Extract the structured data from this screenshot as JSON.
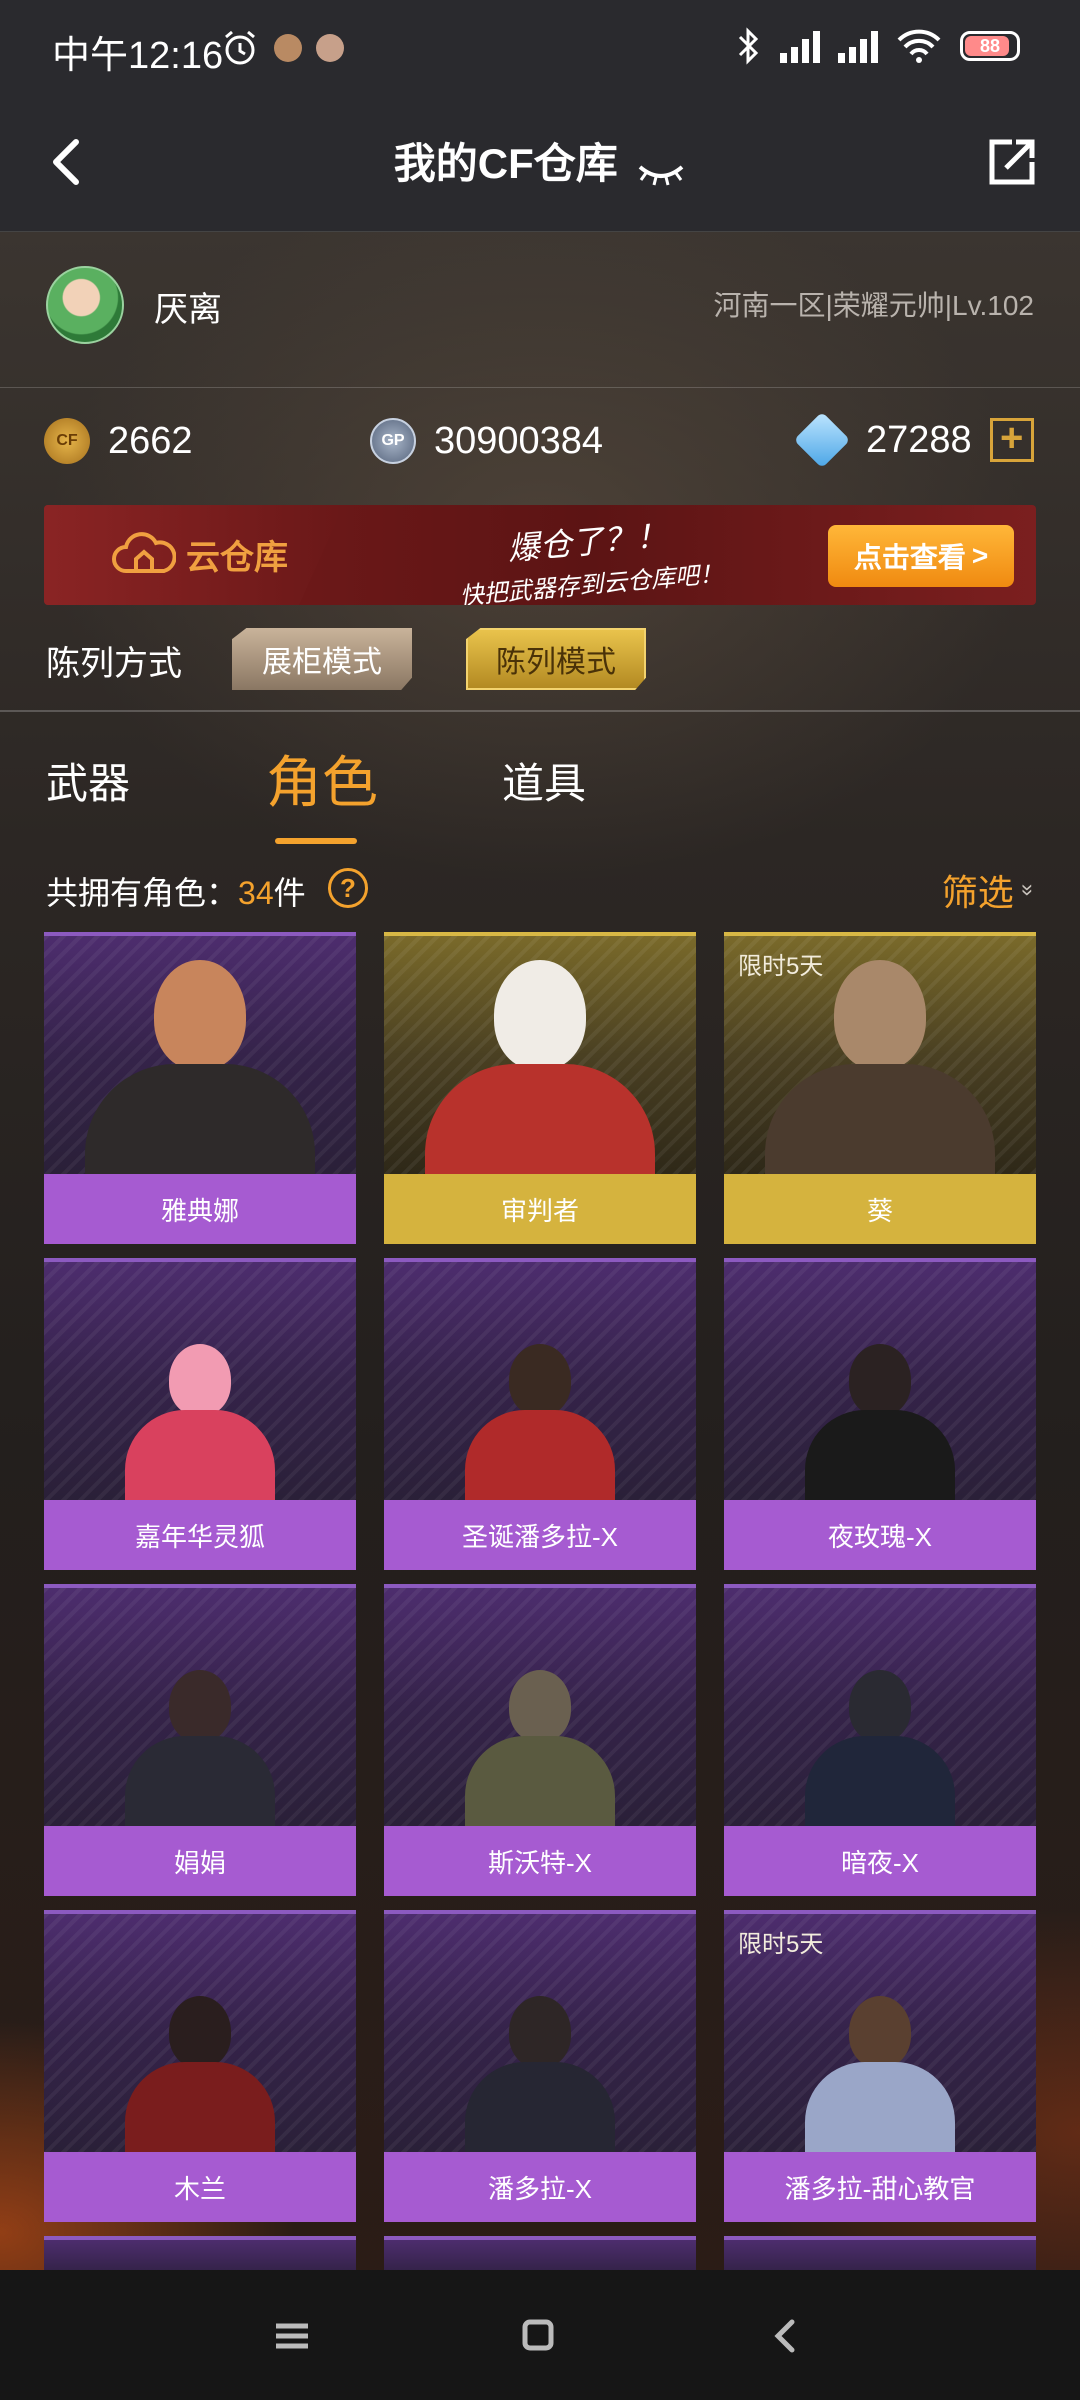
{
  "status_bar": {
    "time": "中午12:16",
    "battery": "88"
  },
  "header": {
    "title": "我的CF仓库"
  },
  "user": {
    "name": "厌离",
    "server": "河南一区|荣耀元帅|Lv.102"
  },
  "currency": {
    "cf_points": "2662",
    "cf_icon_text": "CF",
    "gp": "30900384",
    "gp_icon_text": "GP",
    "diamonds": "27288",
    "plus_symbol": "+"
  },
  "banner": {
    "logo_text": "云仓库",
    "slogan_main": "爆仓了？！",
    "slogan_sub": "快把武器存到云仓库吧！",
    "button_label": "点击查看",
    "button_arrow": ">"
  },
  "display_mode": {
    "label": "陈列方式",
    "options": [
      "展柜模式",
      "陈列模式"
    ],
    "selected": "陈列模式"
  },
  "tabs": [
    {
      "label": "武器",
      "active": false
    },
    {
      "label": "角色",
      "active": true
    },
    {
      "label": "道具",
      "active": false
    }
  ],
  "summary": {
    "label": "共拥有角色：",
    "count": "34",
    "unit": "件",
    "help_symbol": "?",
    "filter_label": "筛选",
    "filter_chevron": "»"
  },
  "characters": [
    {
      "name": "雅典娜",
      "rarity": "purple",
      "tag": ""
    },
    {
      "name": "审判者",
      "rarity": "gold",
      "tag": ""
    },
    {
      "name": "葵",
      "rarity": "gold",
      "tag": "限时5天"
    },
    {
      "name": "嘉年华灵狐",
      "rarity": "purple",
      "tag": ""
    },
    {
      "name": "圣诞潘多拉-X",
      "rarity": "purple",
      "tag": ""
    },
    {
      "name": "夜玫瑰-X",
      "rarity": "purple",
      "tag": ""
    },
    {
      "name": "娟娟",
      "rarity": "purple",
      "tag": ""
    },
    {
      "name": "斯沃特-X",
      "rarity": "purple",
      "tag": ""
    },
    {
      "name": "暗夜-X",
      "rarity": "purple",
      "tag": ""
    },
    {
      "name": "木兰",
      "rarity": "purple",
      "tag": ""
    },
    {
      "name": "潘多拉-X",
      "rarity": "purple",
      "tag": ""
    },
    {
      "name": "潘多拉-甜心教官",
      "rarity": "purple",
      "tag": "限时5天"
    }
  ],
  "colors": {
    "accent": "#f4a22d",
    "purple_card": "#a65bd1",
    "gold_card": "#d5b33e",
    "header_bg": "#2a2a2e"
  }
}
